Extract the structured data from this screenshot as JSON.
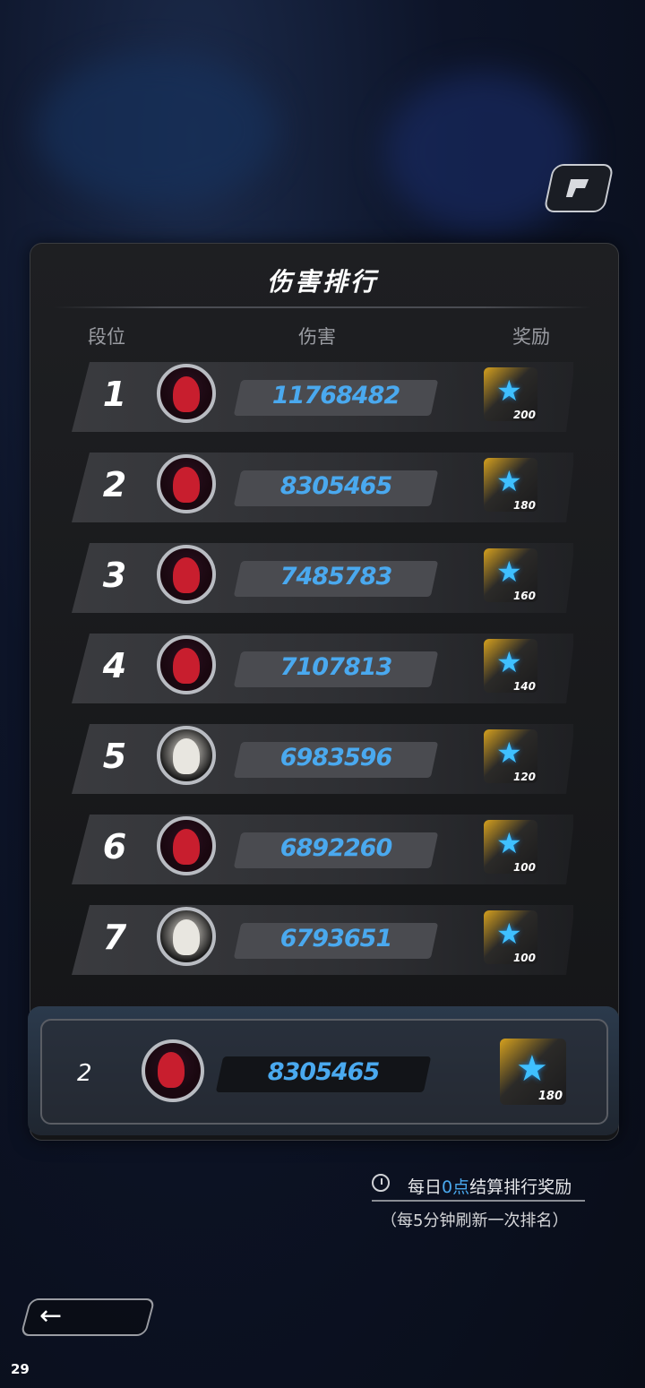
{
  "header": {
    "title": "伤害排行",
    "columns": {
      "rank": "段位",
      "damage": "伤害",
      "reward": "奖励"
    }
  },
  "ranking": [
    {
      "rank": "1",
      "damage": "11768482",
      "reward": "200",
      "avatar": "red-demon-girl-avatar"
    },
    {
      "rank": "2",
      "damage": "8305465",
      "reward": "180",
      "avatar": "red-demon-girl-avatar"
    },
    {
      "rank": "3",
      "damage": "7485783",
      "reward": "160",
      "avatar": "red-demon-girl-avatar"
    },
    {
      "rank": "4",
      "damage": "7107813",
      "reward": "140",
      "avatar": "red-demon-girl-avatar"
    },
    {
      "rank": "5",
      "damage": "6983596",
      "reward": "120",
      "avatar": "white-hair-girl-avatar"
    },
    {
      "rank": "6",
      "damage": "6892260",
      "reward": "100",
      "avatar": "red-demon-girl-avatar"
    },
    {
      "rank": "7",
      "damage": "6793651",
      "reward": "100",
      "avatar": "white-hair-girl-avatar"
    }
  ],
  "self": {
    "rank": "2",
    "damage": "8305465",
    "reward": "180",
    "avatar": "red-demon-girl-avatar"
  },
  "notice": {
    "prefix": "每日",
    "highlight": "0点",
    "suffix": "结算排行奖励",
    "refresh": "（每5分钟刷新一次排名）"
  },
  "footer": {
    "corner_number": "29"
  },
  "icons": {
    "reward": "blue-star-icon",
    "back": "back-arrow-icon",
    "top_button": "p-logo-icon",
    "clock": "clock-icon"
  },
  "colors": {
    "accent": "#4aa9ef",
    "star": "#3fc0ff",
    "gold": "#d6a11e"
  }
}
